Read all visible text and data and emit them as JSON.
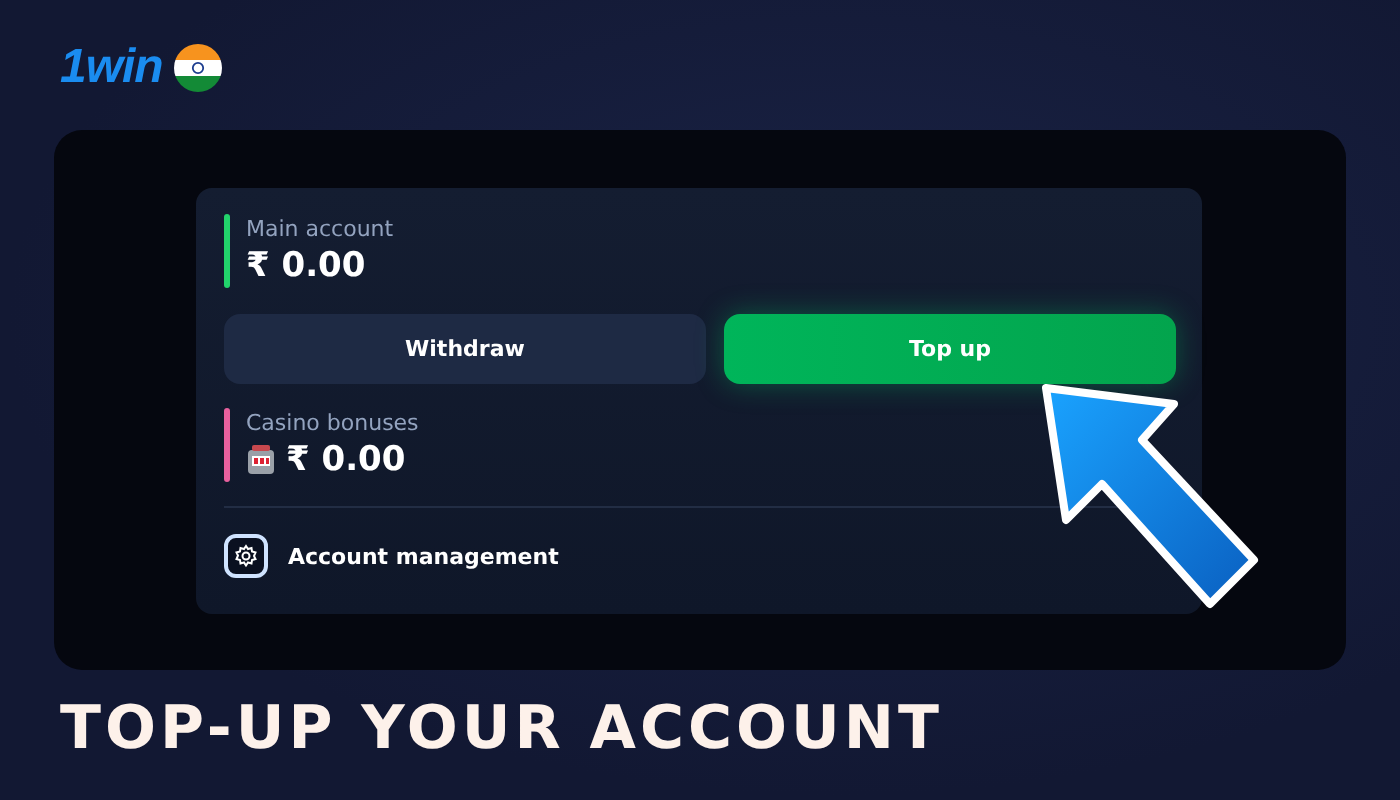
{
  "logo": {
    "text": "1win"
  },
  "balances": [
    {
      "kind": "main",
      "label": "Main account",
      "amount": "₹ 0.00",
      "color": "#22d36b"
    },
    {
      "kind": "casino",
      "label": "Casino bonuses",
      "amount": "₹ 0.00",
      "color": "#e8609e"
    }
  ],
  "buttons": [
    {
      "kind": "secondary",
      "label": "Withdraw"
    },
    {
      "kind": "primary",
      "label": "Top up"
    }
  ],
  "menu_item": {
    "label": "Account management"
  },
  "heading": "TOP-UP YOUR ACCOUNT"
}
